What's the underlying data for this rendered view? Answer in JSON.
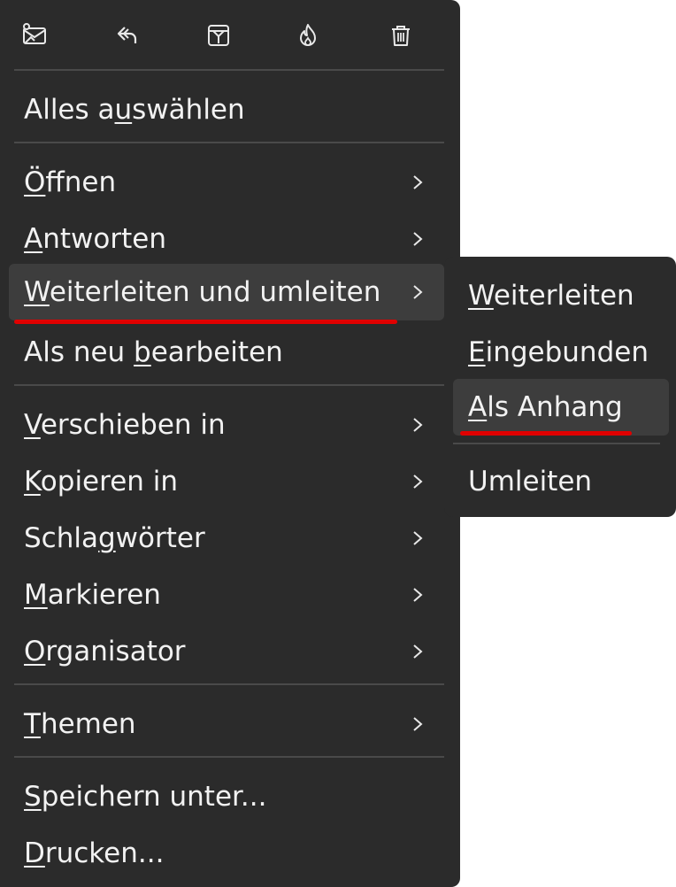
{
  "toolbar": {
    "buttons": [
      {
        "icon": "mail-image-icon"
      },
      {
        "icon": "reply-icon"
      },
      {
        "icon": "archive-icon"
      },
      {
        "icon": "fire-icon"
      },
      {
        "icon": "trash-icon"
      }
    ]
  },
  "menu": {
    "select_all": {
      "pre": "Alles a",
      "key": "u",
      "post": "swählen"
    },
    "open": {
      "key": "Ö",
      "post": "ffnen"
    },
    "reply": {
      "key": "A",
      "post": "ntworten"
    },
    "forward_redirect": {
      "key": "W",
      "post": "eiterleiten und umleiten"
    },
    "edit_as_new": {
      "pre": "Als neu ",
      "key": "b",
      "post": "earbeiten"
    },
    "move_to": {
      "key": "V",
      "post": "erschieben in"
    },
    "copy_to": {
      "key": "K",
      "post": "opieren in"
    },
    "tags": {
      "pre": "Schla",
      "key": "g",
      "post": "wörter"
    },
    "mark": {
      "key": "M",
      "post": "arkieren"
    },
    "organizer": {
      "key": "O",
      "post": "rganisator"
    },
    "themes": {
      "key": "T",
      "post": "hemen"
    },
    "save_as": {
      "key": "S",
      "post": "peichern unter..."
    },
    "print": {
      "key": "D",
      "post": "rucken..."
    }
  },
  "submenu": {
    "forward": {
      "key": "W",
      "post": "eiterleiten"
    },
    "inline": {
      "key": "E",
      "post": "ingebunden"
    },
    "as_attachment": {
      "key": "A",
      "post": "ls Anhang"
    },
    "redirect": {
      "label": "Umleiten"
    }
  },
  "colors": {
    "menu_bg": "#2b2b2b",
    "hover_bg": "#3d3d3d",
    "separator": "#4a4a4a",
    "text": "#f2f2f2",
    "annotation": "#e00000"
  }
}
